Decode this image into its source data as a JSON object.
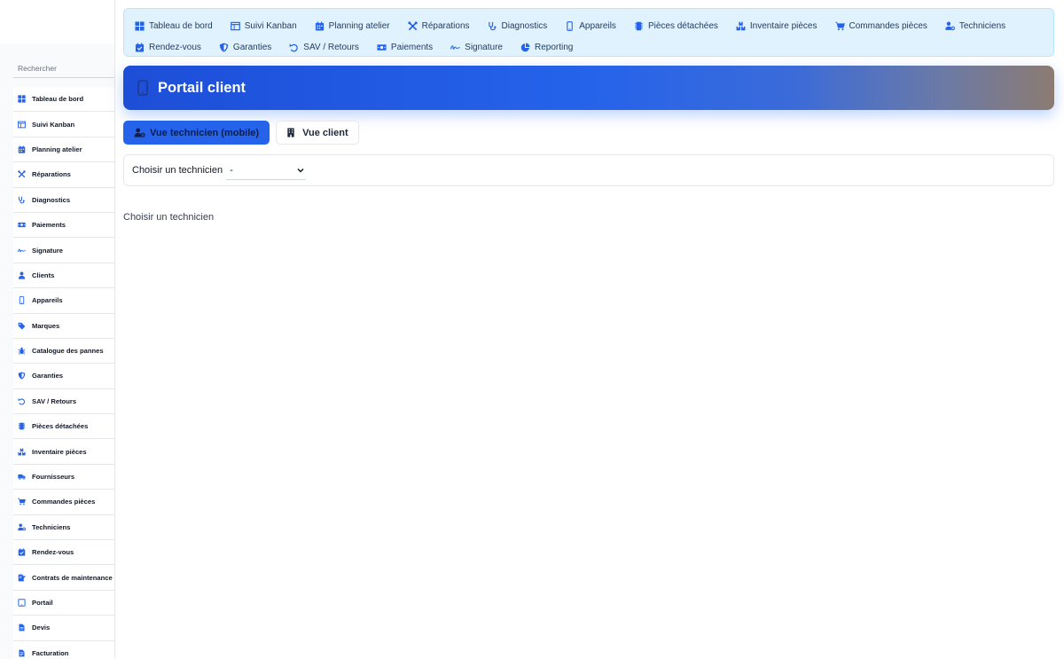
{
  "sidebar": {
    "search_placeholder": "Rechercher",
    "items": [
      {
        "label": "Tableau de bord",
        "icon": "grid-icon"
      },
      {
        "label": "Suivi Kanban",
        "icon": "kanban-icon"
      },
      {
        "label": "Planning atelier",
        "icon": "calendar-icon"
      },
      {
        "label": "Réparations",
        "icon": "tools-icon"
      },
      {
        "label": "Diagnostics",
        "icon": "stethoscope-icon"
      },
      {
        "label": "Paiements",
        "icon": "money-icon"
      },
      {
        "label": "Signature",
        "icon": "signature-icon"
      },
      {
        "label": "Clients",
        "icon": "user-icon"
      },
      {
        "label": "Appareils",
        "icon": "phone-icon"
      },
      {
        "label": "Marques",
        "icon": "tag-icon"
      },
      {
        "label": "Catalogue des pannes",
        "icon": "bug-icon"
      },
      {
        "label": "Garanties",
        "icon": "shield-icon"
      },
      {
        "label": "SAV / Retours",
        "icon": "undo-icon"
      },
      {
        "label": "Pièces détachées",
        "icon": "chip-icon"
      },
      {
        "label": "Inventaire pièces",
        "icon": "boxes-icon"
      },
      {
        "label": "Fournisseurs",
        "icon": "truck-icon"
      },
      {
        "label": "Commandes pièces",
        "icon": "cart-icon"
      },
      {
        "label": "Techniciens",
        "icon": "user-gear-icon"
      },
      {
        "label": "Rendez-vous",
        "icon": "calendar-check-icon"
      },
      {
        "label": "Contrats de maintenance",
        "icon": "contract-icon"
      },
      {
        "label": "Portail",
        "icon": "tablet-icon"
      },
      {
        "label": "Devis",
        "icon": "file-icon"
      },
      {
        "label": "Facturation",
        "icon": "invoice-icon"
      }
    ]
  },
  "topnav": {
    "items": [
      {
        "label": "Tableau de bord",
        "icon": "grid-icon"
      },
      {
        "label": "Suivi Kanban",
        "icon": "kanban-icon"
      },
      {
        "label": "Planning atelier",
        "icon": "calendar-icon"
      },
      {
        "label": "Réparations",
        "icon": "tools-icon"
      },
      {
        "label": "Diagnostics",
        "icon": "stethoscope-icon"
      },
      {
        "label": "Appareils",
        "icon": "phone-icon"
      },
      {
        "label": "Pièces détachées",
        "icon": "chip-icon"
      },
      {
        "label": "Inventaire pièces",
        "icon": "boxes-icon"
      },
      {
        "label": "Commandes pièces",
        "icon": "cart-icon"
      },
      {
        "label": "Techniciens",
        "icon": "user-gear-icon"
      },
      {
        "label": "Rendez-vous",
        "icon": "calendar-check-icon"
      },
      {
        "label": "Garanties",
        "icon": "shield-icon"
      },
      {
        "label": "SAV / Retours",
        "icon": "undo-icon"
      },
      {
        "label": "Paiements",
        "icon": "money-icon"
      },
      {
        "label": "Signature",
        "icon": "signature-icon"
      },
      {
        "label": "Reporting",
        "icon": "pie-icon"
      }
    ]
  },
  "banner": {
    "title": "Portail client",
    "icon": "mobile-icon"
  },
  "views": {
    "technician_label": "Vue technicien (mobile)",
    "client_label": "Vue client",
    "active": "technician"
  },
  "technician_select": {
    "label": "Choisir un technicien",
    "value": "-"
  },
  "empty_message": "Choisir un technicien",
  "colors": {
    "accent": "#2563eb",
    "nav_bg": "#e0f2fe",
    "icon": "#2563eb"
  }
}
